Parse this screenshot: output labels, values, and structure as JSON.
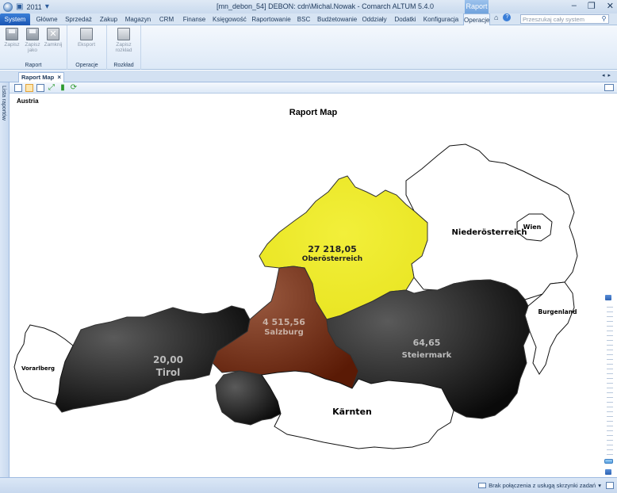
{
  "window": {
    "year": "2011",
    "title": "[mn_debon_54] DEBON: cdn\\Michal.Nowak - Comarch ALTUM 5.4.0",
    "context_tab": "Raport"
  },
  "menu": {
    "items": [
      {
        "label": "System"
      },
      {
        "label": "Główne"
      },
      {
        "label": "Sprzedaż"
      },
      {
        "label": "Zakup"
      },
      {
        "label": "Magazyn"
      },
      {
        "label": "CRM"
      },
      {
        "label": "Finanse"
      },
      {
        "label": "Księgowość"
      },
      {
        "label": "Raportowanie"
      },
      {
        "label": "BSC"
      },
      {
        "label": "Budżetowanie"
      },
      {
        "label": "Oddziały"
      },
      {
        "label": "Dodatki"
      },
      {
        "label": "Konfiguracja"
      },
      {
        "label": "Operacje"
      }
    ],
    "search_placeholder": "Przeszukaj cały system"
  },
  "ribbon": {
    "groups": [
      {
        "label": "Raport",
        "buttons": [
          {
            "label": "Zapisz"
          },
          {
            "label": "Zapisz jako"
          },
          {
            "label": "Zamknij"
          }
        ]
      },
      {
        "label": "Operacje",
        "buttons": [
          {
            "label": "Eksport"
          }
        ]
      },
      {
        "label": "Rozkład",
        "buttons": [
          {
            "label": "Zapisz rozkład"
          }
        ]
      }
    ]
  },
  "tabs": {
    "active_tab": "Raport Map",
    "close_glyph": "×"
  },
  "side_panel": {
    "label": "Lista raportów"
  },
  "map": {
    "country": "Austria",
    "title": "Raport Map",
    "regions": [
      {
        "name": "Oberösterreich",
        "value": "27 218,05",
        "color": "#eeea2a"
      },
      {
        "name": "Salzburg",
        "value": "4 515,56",
        "color": "#7a2a10"
      },
      {
        "name": "Tirol",
        "value": "20,00",
        "color": "#2f2f2f"
      },
      {
        "name": "Steiermark",
        "value": "64,65",
        "color": "#2f2f2f"
      },
      {
        "name": "Kärnten",
        "value": "",
        "color": "#ffffff"
      },
      {
        "name": "Niederösterreich",
        "value": "",
        "color": "#ffffff"
      },
      {
        "name": "Wien",
        "value": "",
        "color": "#ffffff"
      },
      {
        "name": "Burgenland",
        "value": "",
        "color": "#ffffff"
      },
      {
        "name": "Vorarlberg",
        "value": "",
        "color": "#ffffff"
      }
    ]
  },
  "status": {
    "message": "Brak połączenia z usługą skrzynki zadań"
  }
}
